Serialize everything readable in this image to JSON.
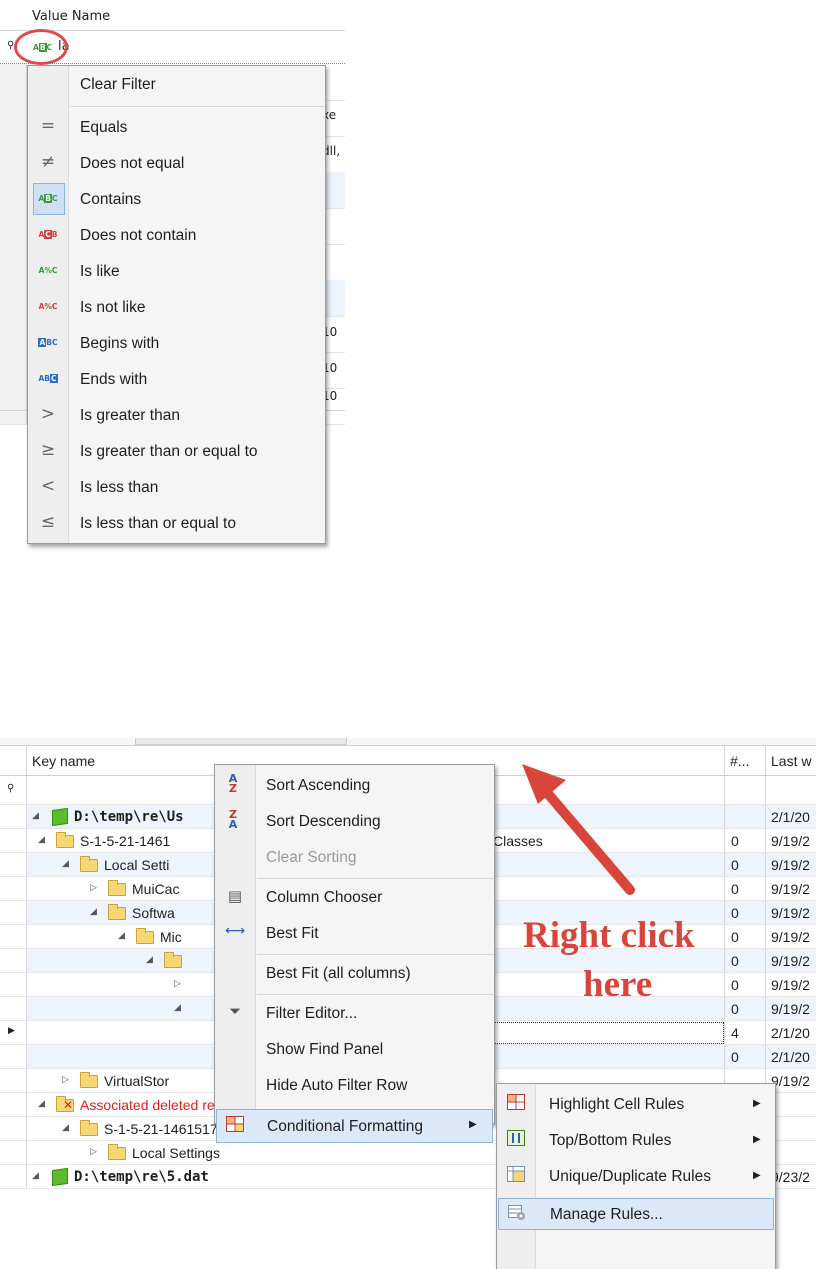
{
  "filter_panel": {
    "column_header": "Value Name",
    "filter_value": "la",
    "filter_icon": "abc-contains-icon",
    "row_fragments": [
      "xe",
      "dll,",
      "10",
      "10",
      "10"
    ],
    "menu": {
      "clear_filter": "Clear Filter",
      "items": [
        {
          "label": "Equals",
          "icon": "equals-icon",
          "glyph": "="
        },
        {
          "label": "Does not equal",
          "icon": "not-equal-icon",
          "glyph": "≠"
        },
        {
          "label": "Contains",
          "icon": "contains-icon",
          "glyph": "ABC"
        },
        {
          "label": "Does not contain",
          "icon": "does-not-contain-icon",
          "glyph": "ACB"
        },
        {
          "label": "Is like",
          "icon": "is-like-icon",
          "glyph": "A%C"
        },
        {
          "label": "Is not like",
          "icon": "is-not-like-icon",
          "glyph": "A%C"
        },
        {
          "label": "Begins with",
          "icon": "begins-with-icon",
          "glyph": "ABC"
        },
        {
          "label": "Ends with",
          "icon": "ends-with-icon",
          "glyph": "ABC"
        },
        {
          "label": "Is greater than",
          "icon": "greater-than-icon",
          "glyph": ">"
        },
        {
          "label": "Is greater than or equal to",
          "icon": "greater-equal-icon",
          "glyph": "≥"
        },
        {
          "label": "Is less than",
          "icon": "less-than-icon",
          "glyph": "<"
        },
        {
          "label": "Is less than or equal to",
          "icon": "less-equal-icon",
          "glyph": "≤"
        }
      ]
    }
  },
  "tree_panel": {
    "columns": {
      "key_name": "Key name",
      "count": "#...",
      "last_write": "Last w"
    },
    "rows": [
      {
        "name": "D:\\temp\\re\\Us",
        "count": "",
        "date": "2/1/20",
        "bold": true
      },
      {
        "name": "S-1-5-21-1461",
        "extra": "Classes",
        "count": "0",
        "date": "9/19/2"
      },
      {
        "name": "Local Setti",
        "count": "0",
        "date": "9/19/2"
      },
      {
        "name": "MuiCac",
        "count": "0",
        "date": "9/19/2"
      },
      {
        "name": "Softwa",
        "count": "0",
        "date": "9/19/2"
      },
      {
        "name": "Mic",
        "count": "0",
        "date": "9/19/2"
      },
      {
        "name": "",
        "count": "0",
        "date": "9/19/2"
      },
      {
        "name": "",
        "count": "0",
        "date": "9/19/2"
      },
      {
        "name": "",
        "count": "0",
        "date": "9/19/2"
      },
      {
        "name": "",
        "count": "4",
        "date": "2/1/20"
      },
      {
        "name": "",
        "count": "0",
        "date": "2/1/20"
      },
      {
        "name": "VirtualStor",
        "count": "",
        "date": "9/19/2"
      },
      {
        "name": "Associated deleted records",
        "count": "",
        "date": ""
      },
      {
        "name": "S-1-5-21-146151751-63468248-1215037915-100",
        "count": "",
        "date": ""
      },
      {
        "name": "Local Settings",
        "count": "",
        "date": ""
      },
      {
        "name": "D:\\temp\\re\\5.dat",
        "count": "",
        "date": "9/23/2",
        "bold": true
      }
    ],
    "column_menu": {
      "sort_ascending": "Sort Ascending",
      "sort_descending": "Sort Descending",
      "clear_sorting": "Clear Sorting",
      "column_chooser": "Column Chooser",
      "best_fit": "Best Fit",
      "best_fit_all": "Best Fit (all columns)",
      "filter_editor": "Filter Editor...",
      "show_find_panel": "Show Find Panel",
      "hide_auto_filter_row": "Hide Auto Filter Row",
      "conditional_formatting": "Conditional Formatting"
    },
    "submenu": {
      "highlight_cell_rules": "Highlight Cell Rules",
      "top_bottom_rules": "Top/Bottom Rules",
      "unique_duplicate_rules": "Unique/Duplicate Rules",
      "manage_rules": "Manage Rules..."
    },
    "annotation": {
      "line1": "Right click",
      "line2": "here"
    }
  },
  "colors": {
    "annotation": "#d9453b",
    "selection": "#dbe8f7",
    "deleted_text": "#e02020"
  }
}
